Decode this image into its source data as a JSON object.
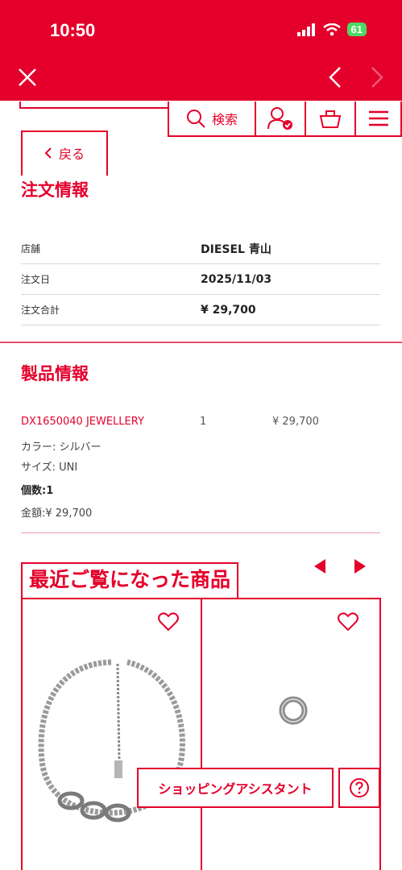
{
  "status_bar": {
    "time": "10:50",
    "battery": "61"
  },
  "header": {
    "search_label": "検索"
  },
  "back": {
    "label": "戻る"
  },
  "order_info": {
    "title": "注文情報",
    "rows": [
      {
        "label": "店舗",
        "value": "DIESEL 青山"
      },
      {
        "label": "注文日",
        "value": "2025/11/03"
      },
      {
        "label": "注文合計",
        "value": "¥ 29,700"
      }
    ]
  },
  "product_info": {
    "title": "製品情報",
    "name": "DX1650040 JEWELLERY",
    "quantity": "1",
    "price": "¥ 29,700",
    "color": "カラー: シルバー",
    "size": "サイズ: UNI",
    "count": "個数:1",
    "amount": "金額:¥ 29,700"
  },
  "recently_viewed": {
    "title": "最近ご覧になった商品"
  },
  "assistant": {
    "label": "ショッピングアシスタント"
  },
  "colors": {
    "brand": "#e4002b"
  },
  "icons": [
    "close-icon",
    "chevron-left-icon",
    "chevron-right-icon",
    "search-icon",
    "user-icon",
    "cart-icon",
    "menu-icon",
    "heart-icon",
    "help-icon"
  ]
}
